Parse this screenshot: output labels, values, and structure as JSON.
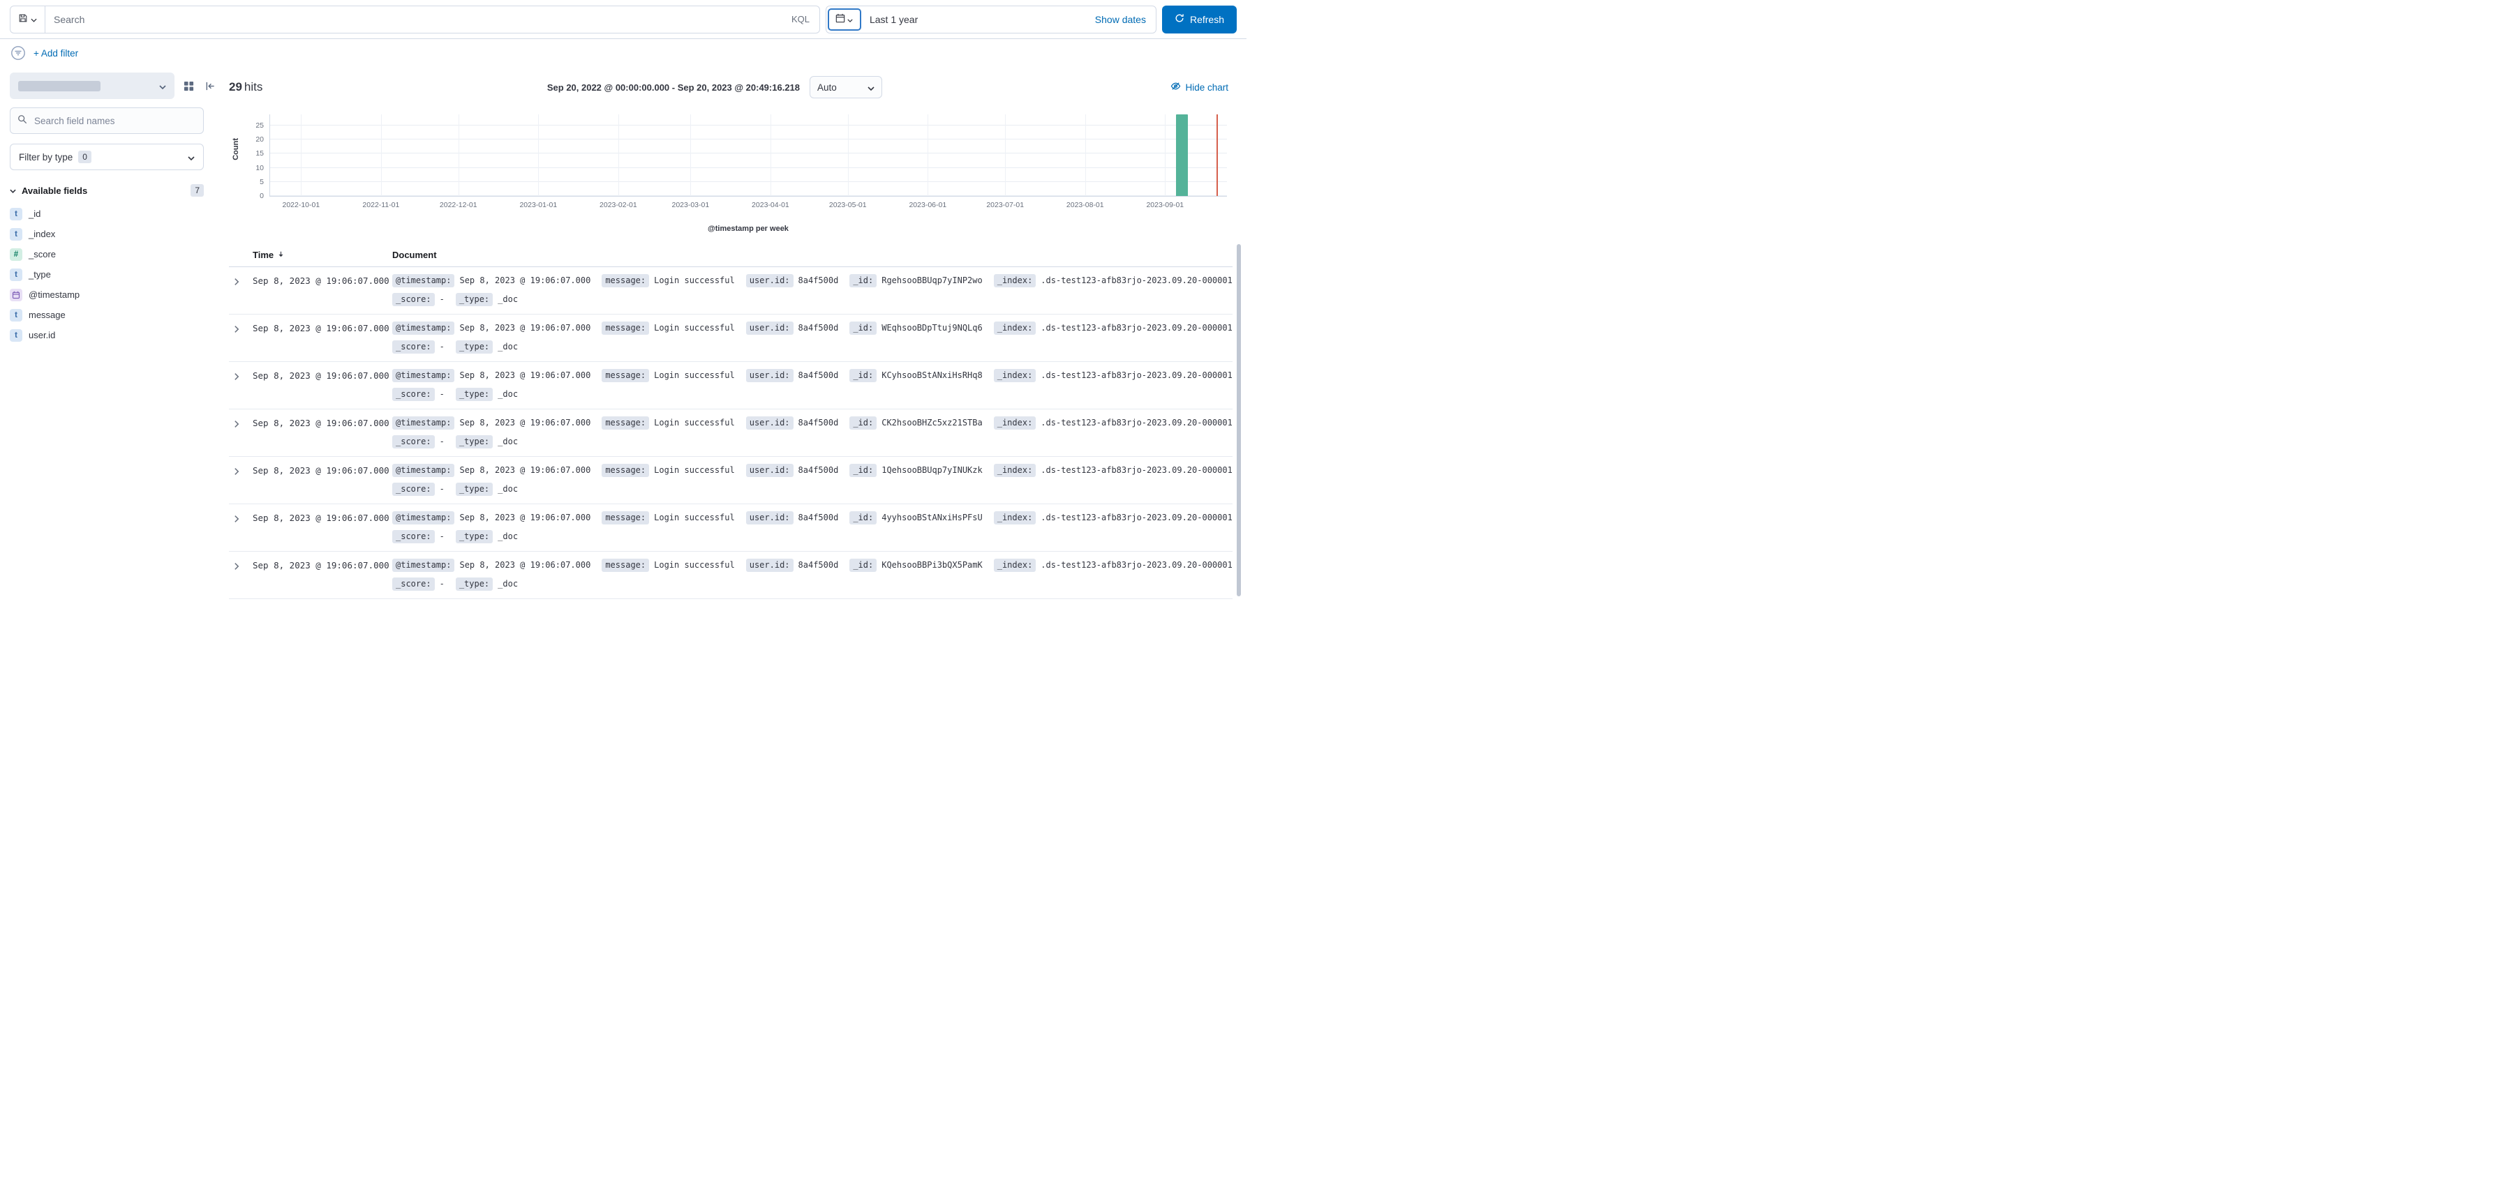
{
  "colors": {
    "primary": "#0071c2",
    "link": "#006bb4",
    "badge_bg": "#e0e5ee"
  },
  "query_bar": {
    "search_placeholder": "Search",
    "kql_label": "KQL",
    "time_range_label": "Last 1 year",
    "show_dates_label": "Show dates",
    "refresh_label": "Refresh"
  },
  "filter_bar": {
    "add_filter_label": "+ Add filter"
  },
  "sidebar": {
    "field_search_placeholder": "Search field names",
    "filter_by_type": {
      "label": "Filter by type",
      "count": "0"
    },
    "available_fields": {
      "label": "Available fields",
      "count": "7"
    },
    "fields": [
      {
        "name": "_id",
        "icon": "t"
      },
      {
        "name": "_index",
        "icon": "t"
      },
      {
        "name": "_score",
        "icon": "#"
      },
      {
        "name": "_type",
        "icon": "t"
      },
      {
        "name": "@timestamp",
        "icon": "calendar"
      },
      {
        "name": "message",
        "icon": "t"
      },
      {
        "name": "user.id",
        "icon": "t"
      }
    ]
  },
  "main": {
    "hits_count": "29",
    "hits_label": "hits",
    "date_range": "Sep 20, 2022 @ 00:00:00.000 - Sep 20, 2023 @ 20:49:16.218",
    "interval_value": "Auto",
    "hide_chart_label": "Hide chart"
  },
  "chart_data": {
    "type": "bar",
    "title": "",
    "xlabel": "@timestamp per week",
    "ylabel": "Count",
    "y_ticks": [
      0,
      5,
      10,
      15,
      20,
      25
    ],
    "ylim": [
      0,
      29
    ],
    "x_ticks": [
      "2022-10-01",
      "2022-11-01",
      "2022-12-01",
      "2023-01-01",
      "2023-02-01",
      "2023-03-01",
      "2023-04-01",
      "2023-05-01",
      "2023-06-01",
      "2023-07-01",
      "2023-08-01",
      "2023-09-01"
    ],
    "x_domain": [
      "2022-09-19",
      "2023-09-25"
    ],
    "bars": [
      {
        "x_start": "2023-09-04",
        "x_end": "2023-09-11",
        "value": 29
      }
    ],
    "bar_color": "#54b399",
    "annotation": {
      "x": "2023-09-20T20:49:16",
      "color": "#d6604d"
    },
    "grid": true,
    "legend": false
  },
  "table": {
    "columns": {
      "time": "Time",
      "document": "Document"
    },
    "rows": [
      {
        "time": "Sep 8, 2023 @ 19:06:07.000",
        "line1": [
          {
            "field": "@timestamp:",
            "value": "Sep 8, 2023 @ 19:06:07.000"
          },
          {
            "field": "message:",
            "value": "Login successful"
          },
          {
            "field": "user.id:",
            "value": "8a4f500d"
          },
          {
            "field": "_id:",
            "value": "RgehsooBBUqp7yINP2wo"
          },
          {
            "field": "_index:",
            "value": ".ds-test123-afb83rjo-2023.09.20-000001"
          }
        ],
        "line2": [
          {
            "field": "_score:",
            "value": "-"
          },
          {
            "field": "_type:",
            "value": "_doc"
          }
        ]
      },
      {
        "time": "Sep 8, 2023 @ 19:06:07.000",
        "line1": [
          {
            "field": "@timestamp:",
            "value": "Sep 8, 2023 @ 19:06:07.000"
          },
          {
            "field": "message:",
            "value": "Login successful"
          },
          {
            "field": "user.id:",
            "value": "8a4f500d"
          },
          {
            "field": "_id:",
            "value": "WEqhsooBDpTtuj9NQLq6"
          },
          {
            "field": "_index:",
            "value": ".ds-test123-afb83rjo-2023.09.20-000001"
          }
        ],
        "line2": [
          {
            "field": "_score:",
            "value": "-"
          },
          {
            "field": "_type:",
            "value": "_doc"
          }
        ]
      },
      {
        "time": "Sep 8, 2023 @ 19:06:07.000",
        "line1": [
          {
            "field": "@timestamp:",
            "value": "Sep 8, 2023 @ 19:06:07.000"
          },
          {
            "field": "message:",
            "value": "Login successful"
          },
          {
            "field": "user.id:",
            "value": "8a4f500d"
          },
          {
            "field": "_id:",
            "value": "KCyhsooBStANxiHsRHq8"
          },
          {
            "field": "_index:",
            "value": ".ds-test123-afb83rjo-2023.09.20-000001"
          }
        ],
        "line2": [
          {
            "field": "_score:",
            "value": "-"
          },
          {
            "field": "_type:",
            "value": "_doc"
          }
        ]
      },
      {
        "time": "Sep 8, 2023 @ 19:06:07.000",
        "line1": [
          {
            "field": "@timestamp:",
            "value": "Sep 8, 2023 @ 19:06:07.000"
          },
          {
            "field": "message:",
            "value": "Login successful"
          },
          {
            "field": "user.id:",
            "value": "8a4f500d"
          },
          {
            "field": "_id:",
            "value": "CK2hsooBHZc5xz21STBa"
          },
          {
            "field": "_index:",
            "value": ".ds-test123-afb83rjo-2023.09.20-000001"
          }
        ],
        "line2": [
          {
            "field": "_score:",
            "value": "-"
          },
          {
            "field": "_type:",
            "value": "_doc"
          }
        ]
      },
      {
        "time": "Sep 8, 2023 @ 19:06:07.000",
        "line1": [
          {
            "field": "@timestamp:",
            "value": "Sep 8, 2023 @ 19:06:07.000"
          },
          {
            "field": "message:",
            "value": "Login successful"
          },
          {
            "field": "user.id:",
            "value": "8a4f500d"
          },
          {
            "field": "_id:",
            "value": "1QehsooBBUqp7yINUKzk"
          },
          {
            "field": "_index:",
            "value": ".ds-test123-afb83rjo-2023.09.20-000001"
          }
        ],
        "line2": [
          {
            "field": "_score:",
            "value": "-"
          },
          {
            "field": "_type:",
            "value": "_doc"
          }
        ]
      },
      {
        "time": "Sep 8, 2023 @ 19:06:07.000",
        "line1": [
          {
            "field": "@timestamp:",
            "value": "Sep 8, 2023 @ 19:06:07.000"
          },
          {
            "field": "message:",
            "value": "Login successful"
          },
          {
            "field": "user.id:",
            "value": "8a4f500d"
          },
          {
            "field": "_id:",
            "value": "4yyhsooBStANxiHsPFsU"
          },
          {
            "field": "_index:",
            "value": ".ds-test123-afb83rjo-2023.09.20-000001"
          }
        ],
        "line2": [
          {
            "field": "_score:",
            "value": "-"
          },
          {
            "field": "_type:",
            "value": "_doc"
          }
        ]
      },
      {
        "time": "Sep 8, 2023 @ 19:06:07.000",
        "line1": [
          {
            "field": "@timestamp:",
            "value": "Sep 8, 2023 @ 19:06:07.000"
          },
          {
            "field": "message:",
            "value": "Login successful"
          },
          {
            "field": "user.id:",
            "value": "8a4f500d"
          },
          {
            "field": "_id:",
            "value": "KQehsooBBPi3bQX5PamK"
          },
          {
            "field": "_index:",
            "value": ".ds-test123-afb83rjo-2023.09.20-000001"
          }
        ],
        "line2": [
          {
            "field": "_score:",
            "value": "-"
          },
          {
            "field": "_type:",
            "value": "_doc"
          }
        ]
      }
    ]
  }
}
